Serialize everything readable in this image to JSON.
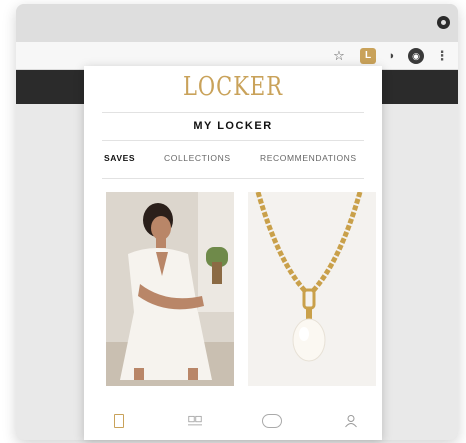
{
  "browser": {
    "icons": [
      "star-icon",
      "locker-extension-icon",
      "rss-icon",
      "profile-icon",
      "menu-icon",
      "settings-icon"
    ],
    "extension_icon_glyph": "L",
    "menu_glyph": "⋮"
  },
  "popup": {
    "logo": "LOCKER",
    "title": "MY LOCKER",
    "tabs": [
      {
        "label": "SAVES",
        "active": true
      },
      {
        "label": "COLLECTIONS",
        "active": false
      },
      {
        "label": "RECOMMENDATIONS",
        "active": false
      }
    ],
    "products": [
      {
        "image": "white-dress-photo"
      },
      {
        "image": "gold-pearl-necklace-photo"
      }
    ],
    "nav": [
      "saves-icon",
      "collections-icon",
      "recommendations-icon",
      "account-icon"
    ]
  },
  "colors": {
    "brand_gold": "#c9a25a",
    "header_bar": "#2b2b2b"
  }
}
